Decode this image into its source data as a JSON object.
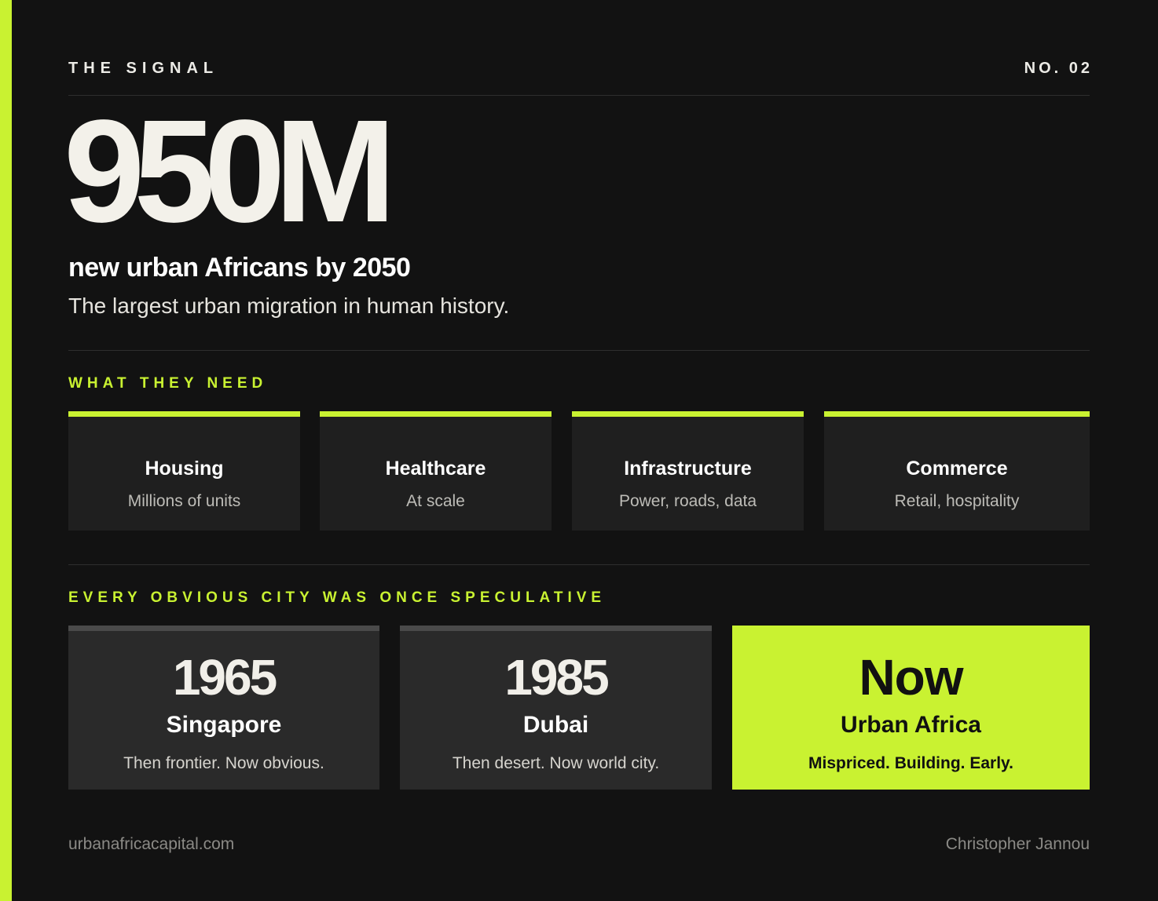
{
  "header": {
    "publication": "THE SIGNAL",
    "issue": "NO. 02"
  },
  "hero": {
    "number": "950M",
    "title": "new urban Africans by 2050",
    "subtitle": "The largest urban migration in human history."
  },
  "needs": {
    "label": "WHAT THEY NEED",
    "items": [
      {
        "title": "Housing",
        "desc": "Millions of units"
      },
      {
        "title": "Healthcare",
        "desc": "At scale"
      },
      {
        "title": "Infrastructure",
        "desc": "Power, roads, data"
      },
      {
        "title": "Commerce",
        "desc": "Retail, hospitality"
      }
    ]
  },
  "cities": {
    "label": "EVERY OBVIOUS CITY WAS ONCE SPECULATIVE",
    "items": [
      {
        "year": "1965",
        "place": "Singapore",
        "note": "Then frontier. Now obvious."
      },
      {
        "year": "1985",
        "place": "Dubai",
        "note": "Then desert. Now world city."
      },
      {
        "year": "Now",
        "place": "Urban Africa",
        "note": "Mispriced. Building. Early."
      }
    ]
  },
  "footer": {
    "website": "urbanafricacapital.com",
    "author": "Christopher Jannou"
  },
  "colors": {
    "background": "#121212",
    "accent": "#c9f231",
    "card": "#1f1f1f",
    "city_card": "#2a2a2a"
  }
}
